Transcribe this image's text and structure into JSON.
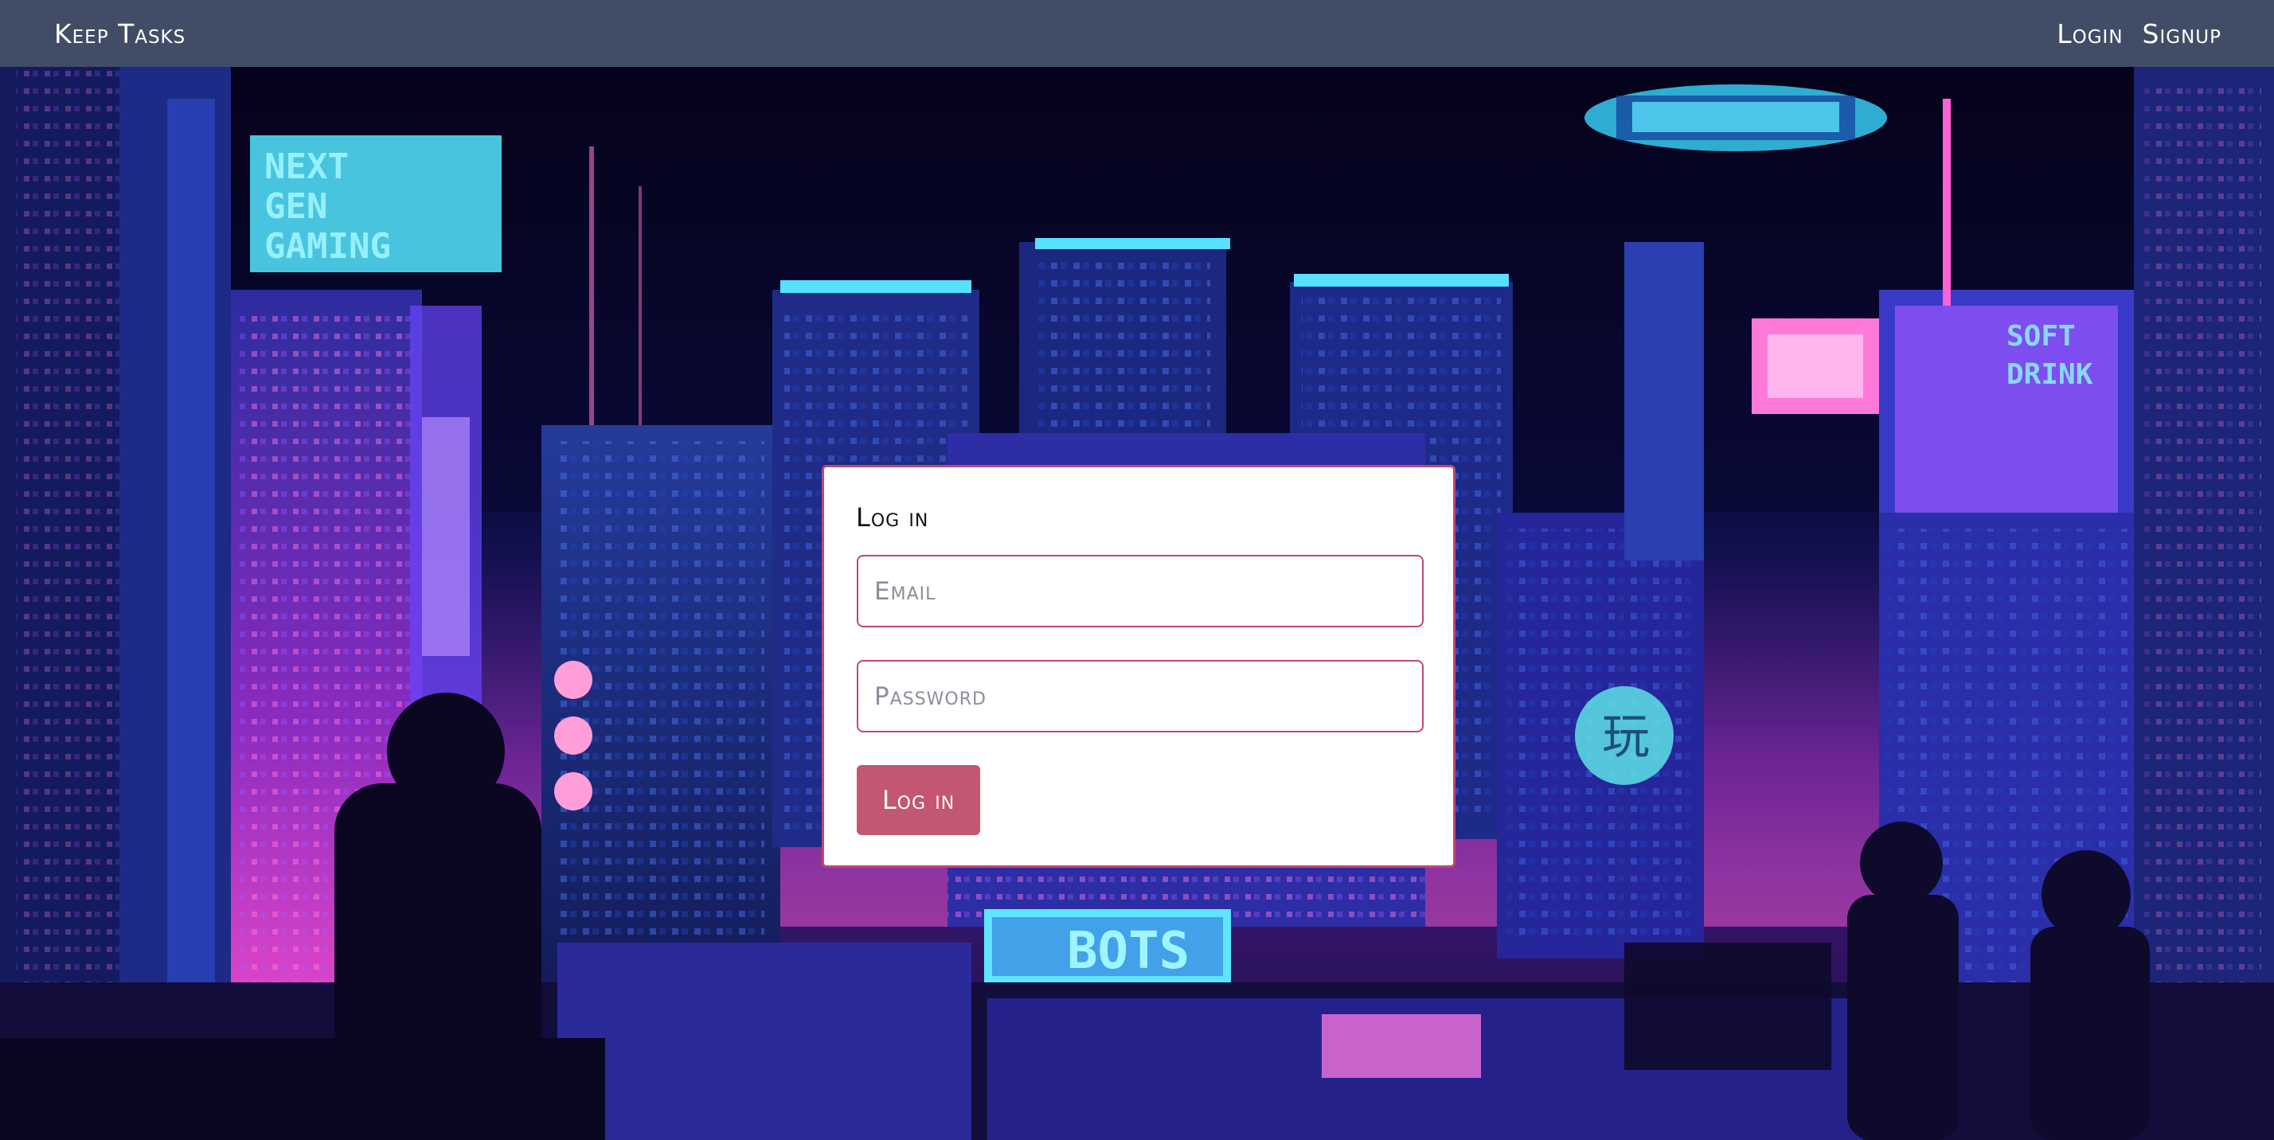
{
  "navbar": {
    "brand": "Keep Tasks",
    "links": [
      {
        "label": "Login"
      },
      {
        "label": "Signup"
      }
    ]
  },
  "background": {
    "signs": {
      "gaming_sign": "NEXT GEN GAMING",
      "bots_sign": "BOTS",
      "soft_drink_sign": "SOFT DRINK",
      "kanji_sign": "玩"
    }
  },
  "login_form": {
    "title": "Log in",
    "email_placeholder": "Email",
    "password_placeholder": "Password",
    "submit_label": "Log in"
  },
  "colors": {
    "navbar": "#414d66",
    "accent": "#c0486a",
    "button": "#c35670"
  }
}
